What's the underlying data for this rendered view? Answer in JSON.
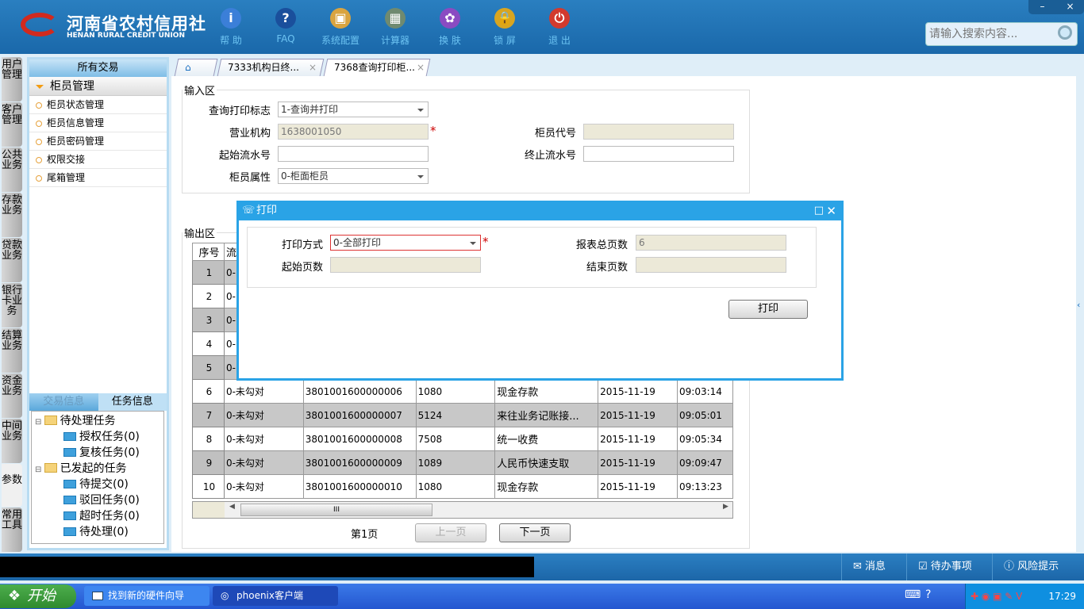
{
  "header": {
    "logo_cn": "河南省农村信用社",
    "logo_en": "HENAN RURAL CREDIT UNION",
    "tools": [
      {
        "label": "帮 助",
        "icon": "info-icon",
        "color": "#3b7fd8",
        "glyph": "i"
      },
      {
        "label": "FAQ",
        "icon": "help-icon",
        "color": "#1a4f9c",
        "glyph": "?"
      },
      {
        "label": "系统配置",
        "icon": "toolbox-icon",
        "color": "#d9a440",
        "glyph": "▣"
      },
      {
        "label": "计算器",
        "icon": "calculator-icon",
        "color": "#6f8a70",
        "glyph": "▦"
      },
      {
        "label": "换 肤",
        "icon": "shirt-icon",
        "color": "#8a4bc2",
        "glyph": "✿"
      },
      {
        "label": "锁 屏",
        "icon": "lock-icon",
        "color": "#d8a520",
        "glyph": "🔒"
      },
      {
        "label": "退 出",
        "icon": "power-icon",
        "color": "#d23a2e",
        "glyph": "⏻"
      }
    ],
    "minimize": "–",
    "close": "×",
    "search_placeholder": "请输入搜索内容..."
  },
  "vtabs": [
    "用户管理",
    "客户管理",
    "公共业务",
    "存款业务",
    "贷款业务",
    "银行卡业务",
    "结算业务",
    "资金业务",
    "中间业务",
    "参数",
    "常用工具"
  ],
  "left": {
    "title": "所有交易",
    "group": "柜员管理",
    "items": [
      "柜员状态管理",
      "柜员信息管理",
      "柜员密码管理",
      "权限交接",
      "尾箱管理"
    ],
    "tabs": [
      "交易信息",
      "任务信息"
    ],
    "tree": [
      {
        "label": "待处理任务",
        "children": [
          "授权任务(0)",
          "复核任务(0)"
        ]
      },
      {
        "label": "已发起的任务",
        "children": [
          "待提交(0)",
          "驳回任务(0)",
          "超时任务(0)",
          "待处理(0)"
        ]
      }
    ]
  },
  "tabs": [
    "7333机构日终...",
    "7368查询打印柜..."
  ],
  "input": {
    "legend": "输入区",
    "flag_label": "查询打印标志",
    "flag_value": "1-查询并打印",
    "org_label": "营业机构",
    "org_value": "1638001050",
    "teller_label": "柜员代号",
    "teller_value": "",
    "start_label": "起始流水号",
    "start_value": "",
    "end_label": "终止流水号",
    "end_value": "",
    "attr_label": "柜员属性",
    "attr_value": "0-柜面柜员"
  },
  "output": {
    "legend": "输出区",
    "headers": [
      "序号",
      "流"
    ],
    "rows": [
      [
        "1",
        "0-",
        "",
        "",
        "",
        "",
        ""
      ],
      [
        "2",
        "0-",
        "",
        "",
        "",
        "",
        ""
      ],
      [
        "3",
        "0-",
        "",
        "",
        "",
        "",
        ""
      ],
      [
        "4",
        "0-",
        "",
        "",
        "",
        "",
        ""
      ],
      [
        "5",
        "0-",
        "",
        "",
        "",
        "",
        ""
      ],
      [
        "6",
        "0-未勾对",
        "3801001600000006",
        "1080",
        "现金存款",
        "2015-11-19",
        "09:03:14"
      ],
      [
        "7",
        "0-未勾对",
        "3801001600000007",
        "5124",
        "来往业务记账接...",
        "2015-11-19",
        "09:05:01"
      ],
      [
        "8",
        "0-未勾对",
        "3801001600000008",
        "7508",
        "统一收费",
        "2015-11-19",
        "09:05:34"
      ],
      [
        "9",
        "0-未勾对",
        "3801001600000009",
        "1089",
        "人民币快速支取",
        "2015-11-19",
        "09:09:47"
      ],
      [
        "10",
        "0-未勾对",
        "3801001600000010",
        "1080",
        "现金存款",
        "2015-11-19",
        "09:13:23"
      ]
    ],
    "page": "第1页",
    "prev": "上一页",
    "next": "下一页",
    "scroll_grip": "III"
  },
  "dialog": {
    "title": "打印",
    "mode_label": "打印方式",
    "mode_value": "0-全部打印",
    "total_label": "报表总页数",
    "total_value": "6",
    "startp_label": "起始页数",
    "startp_value": "",
    "endp_label": "结束页数",
    "endp_value": "",
    "print": "打印"
  },
  "status": {
    "msg": "消息",
    "todo": "待办事项",
    "risk": "风险提示"
  },
  "taskbar": {
    "start": "开始",
    "tasks": [
      "找到新的硬件向导",
      "phoenix客户端"
    ],
    "time": "17:29"
  }
}
